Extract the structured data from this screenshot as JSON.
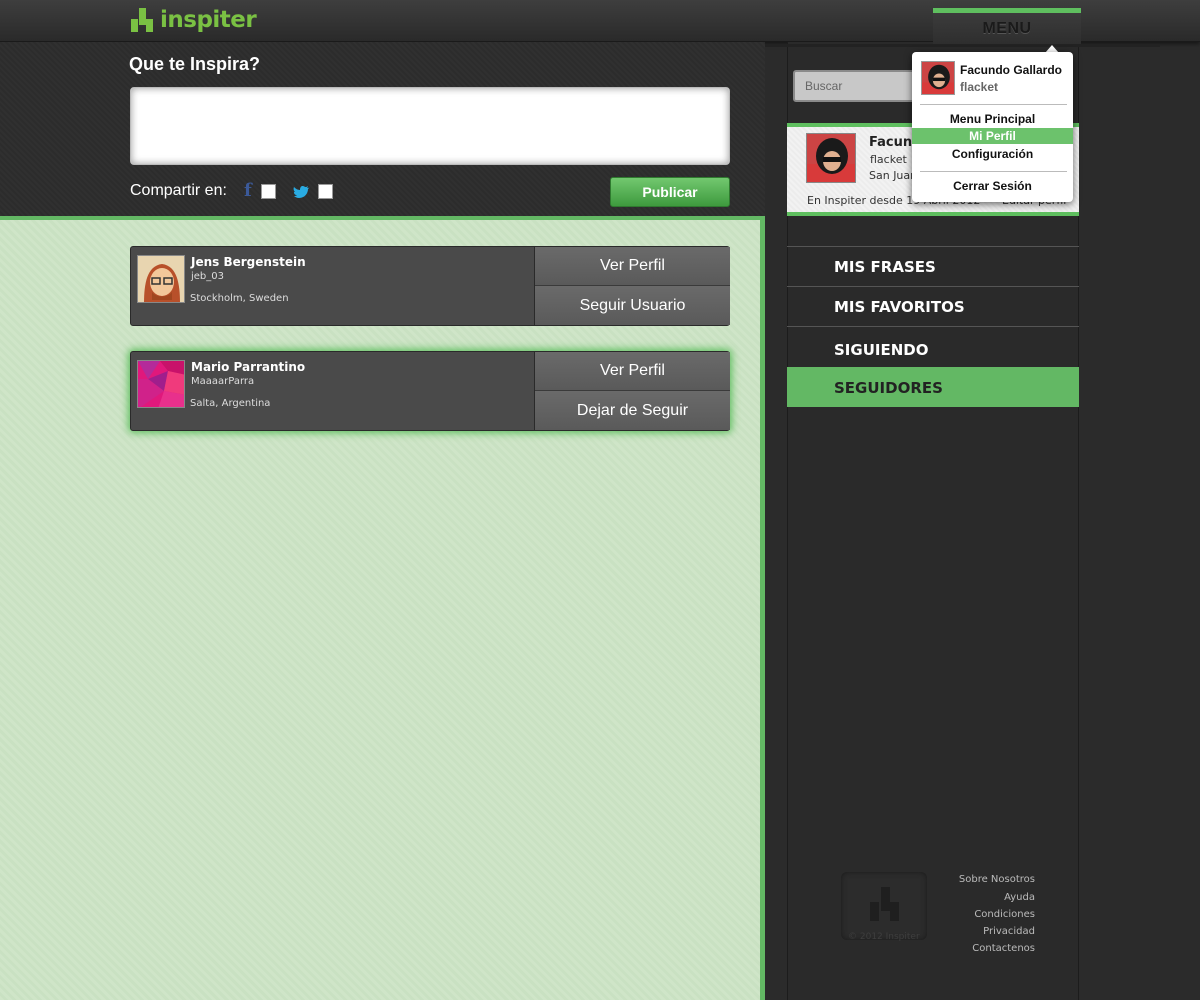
{
  "app": {
    "logo_text": "inspiter",
    "brand_color": "#7ac143",
    "accent_color": "#63b864"
  },
  "compose": {
    "title": "Que te Inspira?",
    "share_label": "Compartir en:",
    "publish_label": "Publicar",
    "share_networks": [
      "facebook-icon",
      "twitter-icon"
    ]
  },
  "users": [
    {
      "name": "Jens Bergenstein",
      "handle": "jeb_03",
      "location": "Stockholm, Sweden",
      "view_label": "Ver Perfil",
      "action_label": "Seguir Usuario"
    },
    {
      "name": "Mario Parrantino",
      "handle": "MaaaarParra",
      "location": "Salta, Argentina",
      "view_label": "Ver Perfil",
      "action_label": "Dejar de Seguir"
    }
  ],
  "header": {
    "menu_label": "MENU",
    "search_placeholder": "Buscar"
  },
  "profile": {
    "name": "Facundo",
    "handle": "flacket",
    "location": "San Juan",
    "since": "En Inspiter desde 19 Abril 2012",
    "edit_label": "Editar perfil"
  },
  "sidebar": {
    "items": [
      {
        "label": "MIS FRASES",
        "active": false
      },
      {
        "label": "MIS FAVORITOS",
        "active": false
      },
      {
        "label": "SIGUIENDO",
        "active": false
      },
      {
        "label": "SEGUIDORES",
        "active": true
      }
    ]
  },
  "footer": {
    "copyright": "© 2012 Inspiter",
    "links": [
      "Sobre Nosotros",
      "Ayuda",
      "Condiciones",
      "Privacidad",
      "Contactenos"
    ]
  },
  "dropdown": {
    "user_name": "Facundo Gallardo",
    "user_handle": "flacket",
    "items": [
      {
        "label": "Menu Principal",
        "active": false
      },
      {
        "label": "Mi Perfil",
        "active": true
      },
      {
        "label": "Configuración",
        "active": false
      },
      {
        "label": "Cerrar Sesión",
        "active": false
      }
    ]
  }
}
